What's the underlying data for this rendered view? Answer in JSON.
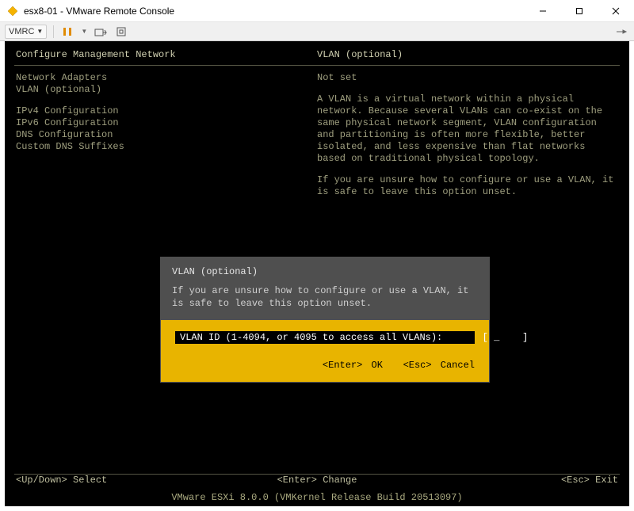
{
  "window": {
    "title": "esx8-01 - VMware Remote Console"
  },
  "toolbar": {
    "vmrc_label": "VMRC"
  },
  "console": {
    "header_left": "Configure Management Network",
    "header_right": "VLAN (optional)",
    "menu": {
      "item0": "Network Adapters",
      "item1": "VLAN (optional)",
      "item2": "IPv4 Configuration",
      "item3": "IPv6 Configuration",
      "item4": "DNS Configuration",
      "item5": "Custom DNS Suffixes"
    },
    "right_status": "Not set",
    "right_p1": "A VLAN is a virtual network within a physical network. Because several VLANs can co-exist on the same physical network segment, VLAN configuration and partitioning is often more flexible, better isolated, and less expensive than flat networks based on traditional physical topology.",
    "right_p2": "If you are unsure how to configure or use a VLAN, it is safe to leave this option unset.",
    "bottom": {
      "left": "<Up/Down> Select",
      "center": "<Enter> Change",
      "right": "<Esc> Exit"
    },
    "footer": "VMware ESXi 8.0.0 (VMKernel Release Build 20513097)"
  },
  "dialog": {
    "title": "VLAN (optional)",
    "subtitle": "If you are unsure how to configure or use a VLAN, it is safe to leave this option unset.",
    "field_label": "VLAN ID (1-4094, or 4095 to access all VLANs):",
    "field_value": "_",
    "foot_enter_key": "<Enter>",
    "foot_enter_label": "OK",
    "foot_esc_key": "<Esc>",
    "foot_esc_label": "Cancel"
  }
}
